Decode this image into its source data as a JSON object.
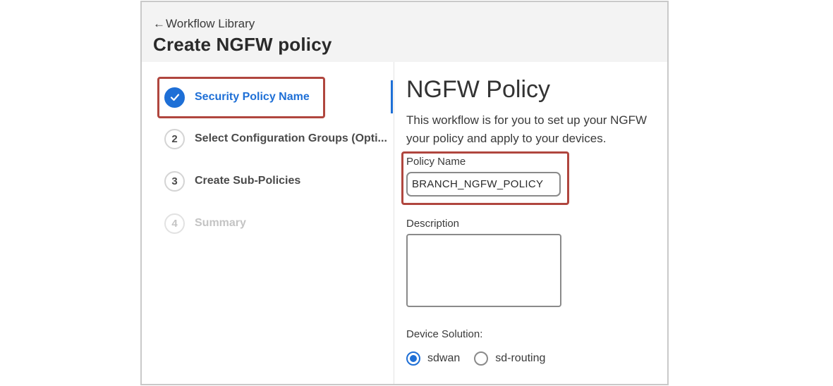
{
  "header": {
    "back_label": "Workflow Library",
    "title": "Create NGFW policy"
  },
  "steps": [
    {
      "number": "",
      "label": "Security Policy Name",
      "state": "complete"
    },
    {
      "number": "2",
      "label": "Select Configuration Groups (Opti...",
      "state": "pending"
    },
    {
      "number": "3",
      "label": "Create Sub-Policies",
      "state": "pending"
    },
    {
      "number": "4",
      "label": "Summary",
      "state": "disabled"
    }
  ],
  "main": {
    "title": "NGFW Policy",
    "intro_line1": "This workflow is for you to set up your NGFW",
    "intro_line2": "your policy and apply to your devices.",
    "policy_name_label": "Policy Name",
    "policy_name_value": "BRANCH_NGFW_POLICY",
    "description_label": "Description",
    "description_value": "",
    "device_solution_label": "Device Solution:",
    "device_solution_options": [
      "sdwan",
      "sd-routing"
    ],
    "device_solution_selected": "sdwan"
  },
  "colors": {
    "accent": "#1e6fd6",
    "highlight": "#b0463e"
  }
}
